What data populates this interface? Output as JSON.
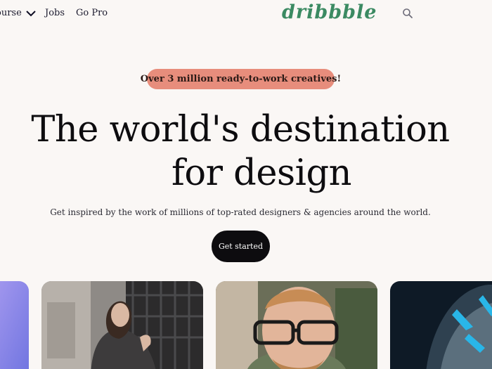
{
  "nav": {
    "course_label": "ourse",
    "jobs_label": "Jobs",
    "gopro_label": "Go Pro",
    "logo_text": "dribbble",
    "logo_color": "#3b8a62",
    "search_icon": "search-icon"
  },
  "hero": {
    "badge": "Over 3 million ready-to-work creatives!",
    "badge_color": "#e78d7c",
    "headline_line1": "The world's destination",
    "headline_line2": "for design",
    "subtitle": "Get inspired by the work of millions of top-rated designers & agencies around the world.",
    "cta_label": "Get started"
  },
  "colors": {
    "background": "#faf7f5",
    "cta": "#0d0c0f"
  }
}
